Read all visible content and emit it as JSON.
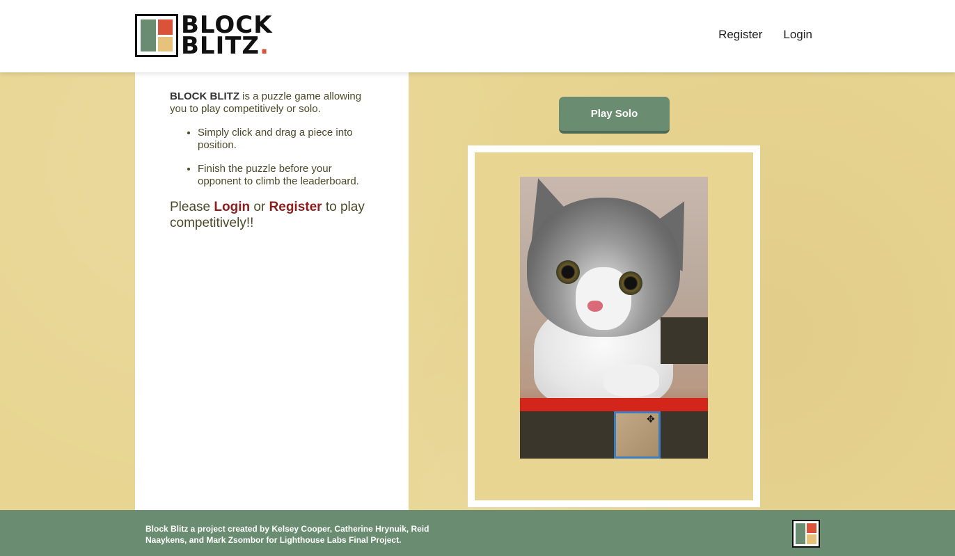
{
  "header": {
    "logo_line1": "BLOCK",
    "logo_line2": "BLITZ",
    "logo_dot": ".",
    "nav": {
      "register": "Register",
      "login": "Login"
    }
  },
  "left_panel": {
    "intro_bold": "BLOCK BLITZ",
    "intro_rest": " is a puzzle game allowing you to play competitively or solo.",
    "tips": [
      "Simply click and drag a piece into position.",
      "Finish the puzzle before your opponent to climb the leaderboard."
    ],
    "cta_prefix": "Please ",
    "cta_login": "Login",
    "cta_or": " or ",
    "cta_register": "Register",
    "cta_suffix": " to play competitively!!"
  },
  "game": {
    "play_solo_label": "Play Solo",
    "cursor_glyph": "✥"
  },
  "footer": {
    "credits": "Block Blitz a project created by Kelsey Cooper, Catherine Hrynuik, Reid Naaykens, and Mark Zsombor for Lighthouse Labs Final Project."
  },
  "colors": {
    "brand_green": "#6a8d71",
    "brand_red": "#d9533b",
    "brand_tan": "#e6c27b",
    "background": "#e8d592",
    "link_red": "#8b1d1d",
    "selection_blue": "#3d7cc0"
  }
}
